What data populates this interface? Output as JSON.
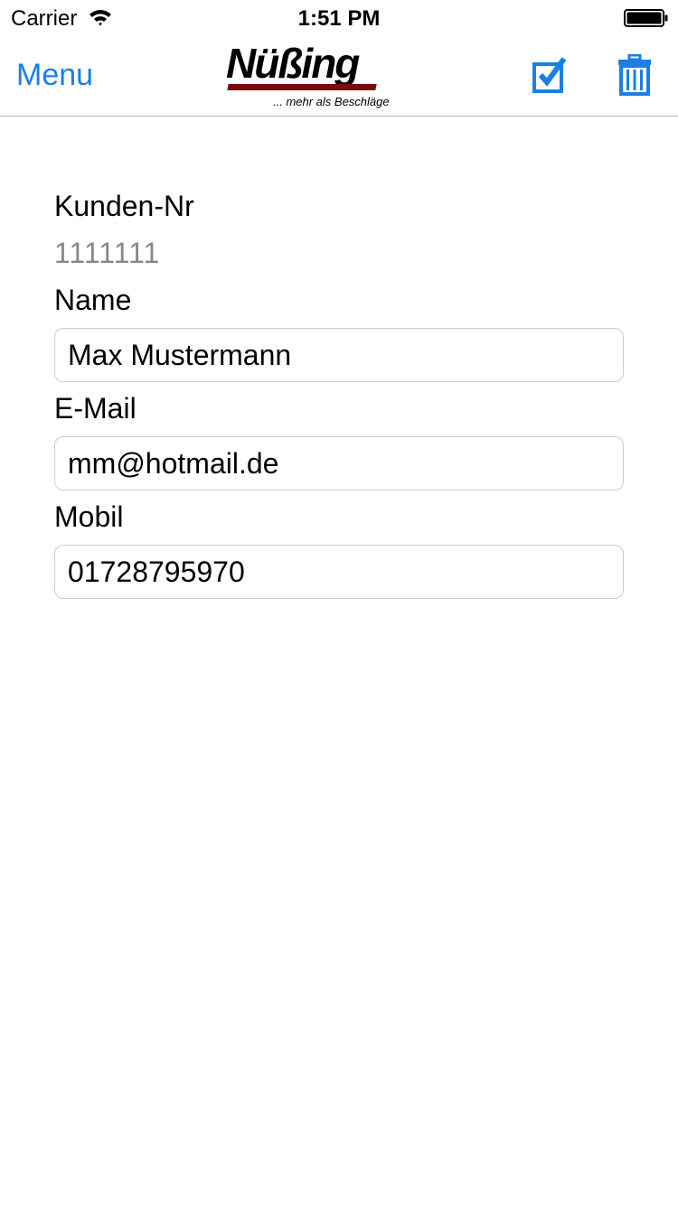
{
  "colors": {
    "accent": "#1a7fe6"
  },
  "status_bar": {
    "carrier": "Carrier",
    "time": "1:51 PM"
  },
  "nav": {
    "menu_label": "Menu",
    "logo_text": "Nüßing",
    "logo_tagline": "... mehr als Beschläge",
    "icons": [
      "wifi-icon",
      "battery-icon",
      "checkbox-icon",
      "trash-icon"
    ]
  },
  "form": {
    "customer_number_label": "Kunden-Nr",
    "customer_number_value": "1111111",
    "name_label": "Name",
    "name_value": "Max Mustermann",
    "email_label": "E-Mail",
    "email_value": "mm@hotmail.de",
    "mobile_label": "Mobil",
    "mobile_value": "01728795970"
  }
}
